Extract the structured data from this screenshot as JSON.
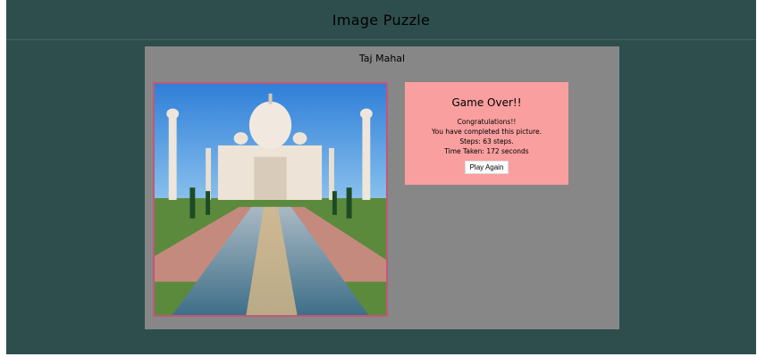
{
  "app": {
    "title": "Image Puzzle"
  },
  "puzzle": {
    "name": "Taj Mahal",
    "image_subject": "taj-mahal-photo"
  },
  "result": {
    "title": "Game Over!!",
    "congrats": "Congratulations!!",
    "message": "You have completed this picture.",
    "steps": "Steps: 63 steps.",
    "time": "Time Taken: 172 seconds",
    "play_again_label": "Play Again"
  },
  "colors": {
    "background": "#2e4e4d",
    "panel": "#878787",
    "result_box": "#f99f9f",
    "image_border": "#c2577a"
  }
}
